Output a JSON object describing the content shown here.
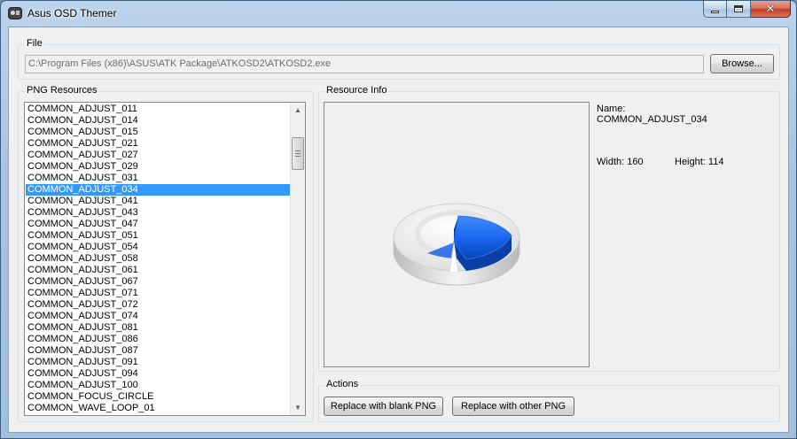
{
  "window": {
    "title": "Asus OSD Themer"
  },
  "file_group": {
    "label": "File",
    "path_value": "C:\\Program Files (x86)\\ASUS\\ATK Package\\ATKOSD2\\ATKOSD2.exe",
    "browse_label": "Browse..."
  },
  "resources_group": {
    "label": "PNG Resources",
    "items": [
      "COMMON_ADJUST_011",
      "COMMON_ADJUST_014",
      "COMMON_ADJUST_015",
      "COMMON_ADJUST_021",
      "COMMON_ADJUST_027",
      "COMMON_ADJUST_029",
      "COMMON_ADJUST_031",
      "COMMON_ADJUST_034",
      "COMMON_ADJUST_041",
      "COMMON_ADJUST_043",
      "COMMON_ADJUST_047",
      "COMMON_ADJUST_051",
      "COMMON_ADJUST_054",
      "COMMON_ADJUST_058",
      "COMMON_ADJUST_061",
      "COMMON_ADJUST_067",
      "COMMON_ADJUST_071",
      "COMMON_ADJUST_072",
      "COMMON_ADJUST_074",
      "COMMON_ADJUST_081",
      "COMMON_ADJUST_086",
      "COMMON_ADJUST_087",
      "COMMON_ADJUST_091",
      "COMMON_ADJUST_094",
      "COMMON_ADJUST_100",
      "COMMON_FOCUS_CIRCLE",
      "COMMON_WAVE_LOOP_01"
    ],
    "selected_index": 7
  },
  "info_group": {
    "label": "Resource Info",
    "name_label": "Name:",
    "name_value": "COMMON_ADJUST_034",
    "width_text": "Width: 160",
    "height_text": "Height: 114"
  },
  "actions_group": {
    "label": "Actions",
    "blank_button": "Replace with blank PNG",
    "other_button": "Replace with other PNG"
  },
  "colors": {
    "selection": "#3399ff",
    "pie_fill": "#1e6ff0"
  }
}
